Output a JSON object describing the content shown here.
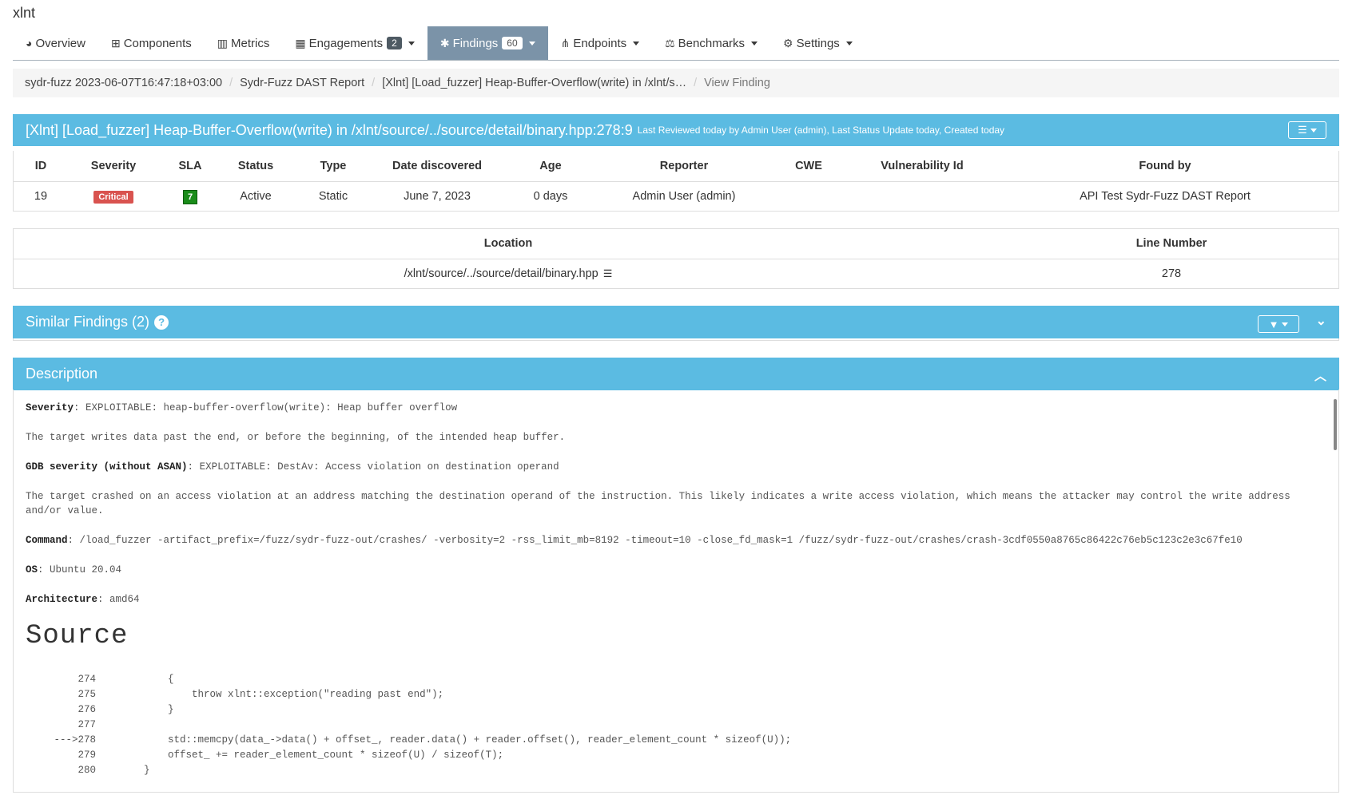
{
  "product": "xlnt",
  "nav": [
    {
      "label": "Overview",
      "icon": "globe-icon",
      "glyph": "◕"
    },
    {
      "label": "Components",
      "icon": "table-icon",
      "glyph": "⊞"
    },
    {
      "label": "Metrics",
      "icon": "bar-chart-icon",
      "glyph": "▥"
    },
    {
      "label": "Engagements",
      "icon": "calendar-icon",
      "glyph": "▦",
      "badge": "2",
      "dropdown": true
    },
    {
      "label": "Findings",
      "icon": "bug-icon",
      "glyph": "✱",
      "badge": "60",
      "dropdown": true,
      "active": true
    },
    {
      "label": "Endpoints",
      "icon": "sitemap-icon",
      "glyph": "⋔",
      "dropdown": true
    },
    {
      "label": "Benchmarks",
      "icon": "balance-scale-icon",
      "glyph": "⚖",
      "dropdown": true
    },
    {
      "label": "Settings",
      "icon": "gears-icon",
      "glyph": "⚙",
      "dropdown": true
    }
  ],
  "breadcrumb": {
    "engagement": "sydr-fuzz 2023-06-07T16:47:18+03:00",
    "test": "Sydr-Fuzz DAST Report",
    "finding": "[Xlnt] [Load_fuzzer] Heap-Buffer-Overflow(write) in /xlnt/s…",
    "current": "View Finding"
  },
  "finding": {
    "title": "[Xlnt] [Load_fuzzer] Heap-Buffer-Overflow(write) in /xlnt/source/../source/detail/binary.hpp:278:9",
    "subtitle": "Last Reviewed today by Admin User (admin), Last Status Update today, Created today",
    "columns": [
      "ID",
      "Severity",
      "SLA",
      "Status",
      "Type",
      "Date discovered",
      "Age",
      "Reporter",
      "CWE",
      "Vulnerability Id",
      "Found by"
    ],
    "row": {
      "id": "19",
      "severity": "Critical",
      "sla": "7",
      "status": "Active",
      "type": "Static",
      "date": "June 7, 2023",
      "age": "0 days",
      "reporter": "Admin User (admin)",
      "cwe": "",
      "vuln_id": "",
      "found_by": "API Test Sydr-Fuzz DAST Report"
    }
  },
  "location": {
    "columns": [
      "Location",
      "Line Number"
    ],
    "path": "/xlnt/source/../source/detail/binary.hpp",
    "line": "278"
  },
  "similar": {
    "title": "Similar Findings (2)",
    "help": "?"
  },
  "description": {
    "title": "Description",
    "severity_label": "Severity",
    "severity_value": "EXPLOITABLE: heap-buffer-overflow(write): Heap buffer overflow",
    "severity_text": "The target writes data past the end, or before the beginning, of the intended heap buffer.",
    "gdb_label": "GDB severity (without ASAN)",
    "gdb_value": "EXPLOITABLE: DestAv: Access violation on destination operand",
    "gdb_text": "The target crashed on an access violation at an address matching the destination operand of the instruction. This likely indicates a write access violation, which means the attacker may control the write address and/or value.",
    "command_label": "Command",
    "command_value": "/load_fuzzer -artifact_prefix=/fuzz/sydr-fuzz-out/crashes/ -verbosity=2 -rss_limit_mb=8192 -timeout=10 -close_fd_mask=1 /fuzz/sydr-fuzz-out/crashes/crash-3cdf0550a8765c86422c76eb5c123c2e3c67fe10",
    "os_label": "OS",
    "os_value": "Ubuntu 20.04",
    "arch_label": "Architecture",
    "arch_value": "amd64",
    "source_heading": "Source",
    "code": [
      {
        "ln": "274",
        "src": "            {"
      },
      {
        "ln": "275",
        "src": "                throw xlnt::exception(\"reading past end\");"
      },
      {
        "ln": "276",
        "src": "            }"
      },
      {
        "ln": "277",
        "src": ""
      },
      {
        "ln": "--->278",
        "src": "            std::memcpy(data_->data() + offset_, reader.data() + reader.offset(), reader_element_count * sizeof(U));"
      },
      {
        "ln": "279",
        "src": "            offset_ += reader_element_count * sizeof(U) / sizeof(T);"
      },
      {
        "ln": "280",
        "src": "        }"
      }
    ]
  }
}
